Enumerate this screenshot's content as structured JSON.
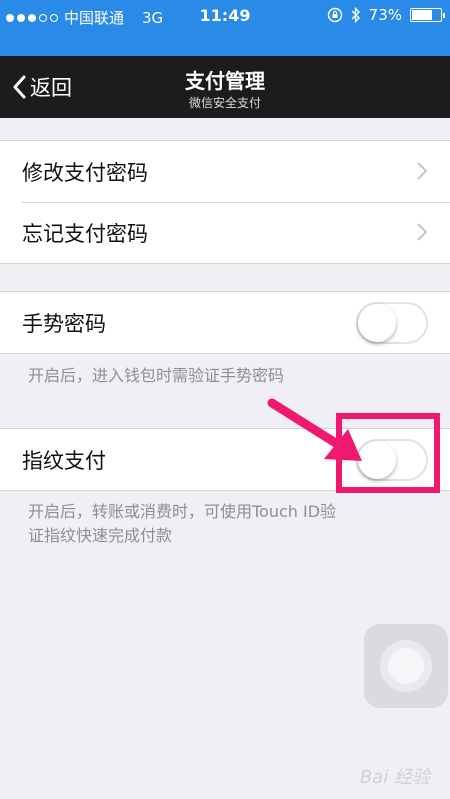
{
  "status_bar": {
    "carrier": "中国联通",
    "network": "3G",
    "time": "11:49",
    "battery": "73%",
    "battery_level": 0.73,
    "signal_bars": 3,
    "signal_total": 5
  },
  "nav": {
    "back_label": "返回",
    "title": "支付管理",
    "subtitle": "微信安全支付"
  },
  "password_group": {
    "items": [
      {
        "label": "修改支付密码"
      },
      {
        "label": "忘记支付密码"
      }
    ]
  },
  "gesture": {
    "label": "手势密码",
    "enabled": false,
    "note": "开启后，进入钱包时需验证手势密码"
  },
  "fingerprint": {
    "label": "指纹支付",
    "enabled": false,
    "note_line1": "开启后，转账或消费时，可使用Touch ID验",
    "note_line2": "证指纹快速完成付款"
  },
  "colors": {
    "status_bar_bg": "#2a8ae8",
    "nav_bg": "#1c1c1c",
    "highlight": "#f0186f",
    "background": "#efeff4"
  },
  "watermark": "Bai 经验"
}
